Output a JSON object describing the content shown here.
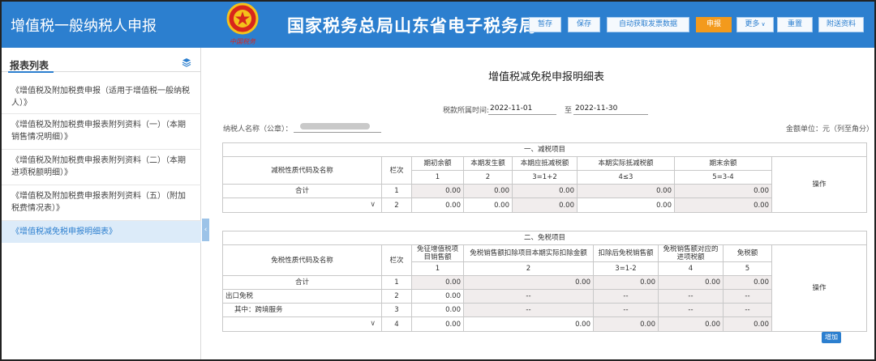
{
  "header": {
    "app_title": "增值税一般纳税人申报",
    "bureau_title": "国家税务总局山东省电子税务局",
    "emblem_caption": "中国税务",
    "buttons": {
      "save_draft": "暂存",
      "save": "保存",
      "auto_fetch": "自动获取发票数据",
      "declare": "申报",
      "more": "更多",
      "reset": "重置",
      "attach": "附送资料"
    }
  },
  "sidebar": {
    "title": "报表列表",
    "items": [
      {
        "label": "《增值税及附加税费申报（适用于增值税一般纳税人）》"
      },
      {
        "label": "《增值税及附加税费申报表附列资料（一）（本期销售情况明细）》"
      },
      {
        "label": "《增值税及附加税费申报表附列资料（二）（本期进项税额明细）》"
      },
      {
        "label": "《增值税及附加税费申报表附列资料（五）（附加税费情况表）》"
      },
      {
        "label": "《增值税减免税申报明细表》"
      }
    ],
    "collapse_glyph": "‹"
  },
  "form": {
    "title": "增值税减免税申报明细表",
    "period_label": "税款所属时间:",
    "period_from": "2022-11-01",
    "period_to_label": "至",
    "period_to": "2022-11-30",
    "taxpayer_label": "纳税人名称（公章）：",
    "unit_label": "金额单位：元（列至角分）"
  },
  "reduction": {
    "section_title": "一、减税项目",
    "col_name": "减税性质代码及名称",
    "col_row": "栏次",
    "col_op": "操作",
    "cols": [
      "期初余额",
      "本期发生额",
      "本期应抵减税额",
      "本期实际抵减税额",
      "期末余额"
    ],
    "col_nums": [
      "1",
      "2",
      "3=1+2",
      "4≤3",
      "5=3-4"
    ],
    "rows": [
      {
        "name": "合计",
        "row": "1",
        "values": [
          "0.00",
          "0.00",
          "0.00",
          "0.00",
          "0.00"
        ]
      },
      {
        "name": "",
        "row": "2",
        "values": [
          "0.00",
          "0.00",
          "0.00",
          "0.00",
          "0.00"
        ]
      }
    ],
    "add_label": "增加"
  },
  "exemption": {
    "section_title": "二、免税项目",
    "col_name": "免税性质代码及名称",
    "col_row": "栏次",
    "col_op": "操作",
    "cols": [
      "免征增值税项目销售额",
      "免税销售额扣除项目本期实际扣除金额",
      "扣除后免税销售额",
      "免税销售额对应的进项税额",
      "免税额"
    ],
    "col_nums": [
      "1",
      "2",
      "3=1-2",
      "4",
      "5"
    ],
    "rows": [
      {
        "name": "合计",
        "row": "1",
        "values": [
          "0.00",
          "0.00",
          "0.00",
          "0.00",
          "0.00"
        ]
      },
      {
        "name": "出口免税",
        "row": "2",
        "values": [
          "0.00",
          "--",
          "--",
          "--",
          "--"
        ]
      },
      {
        "name": "其中：跨境服务",
        "row": "3",
        "values": [
          "0.00",
          "--",
          "--",
          "--",
          "--"
        ]
      },
      {
        "name": "",
        "row": "4",
        "values": [
          "0.00",
          "0.00",
          "0.00",
          "0.00",
          "0.00"
        ]
      }
    ],
    "add_label": "增加"
  },
  "colors": {
    "brand": "#2c7fcf",
    "declare": "#f39a1c",
    "readonly": "#f1eded"
  }
}
